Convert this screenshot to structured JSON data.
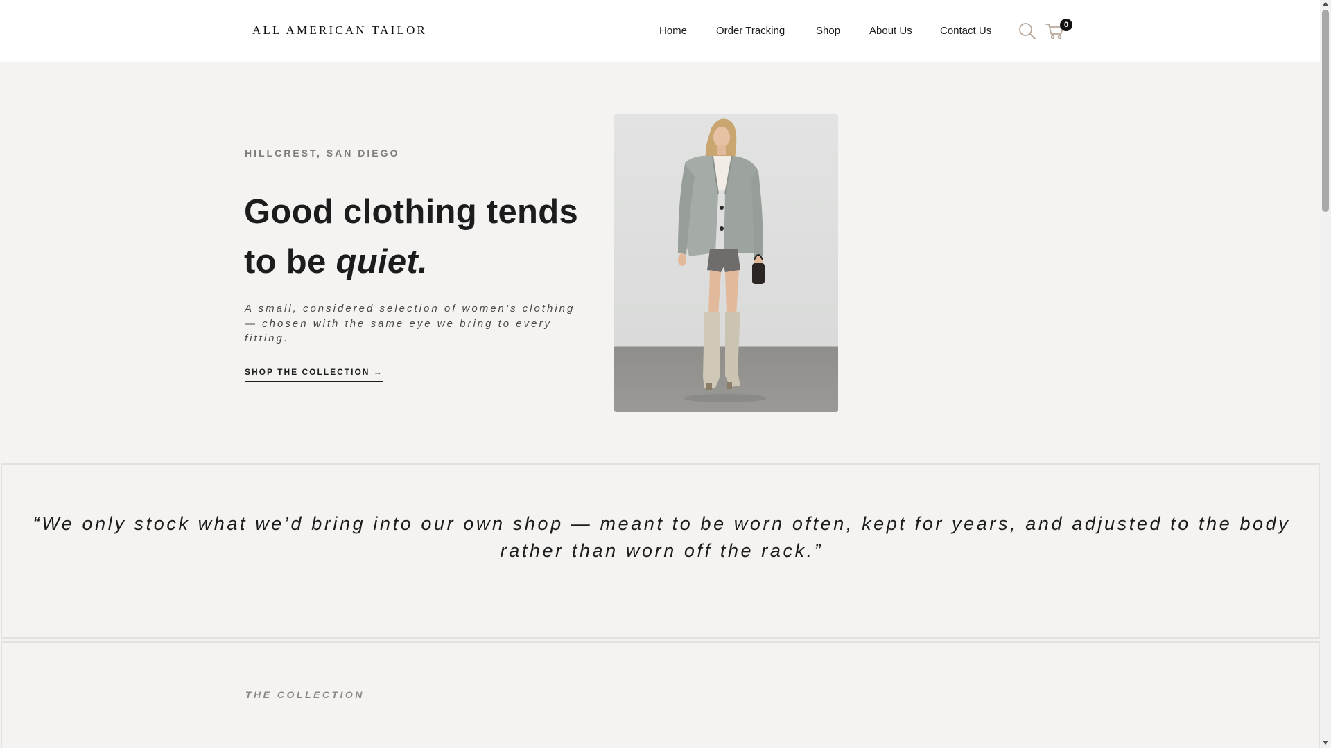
{
  "header": {
    "logo": "ALL AMERICAN TAILOR",
    "nav": [
      "Home",
      "Order Tracking",
      "Shop",
      "About Us",
      "Contact Us"
    ],
    "search_icon": "search-icon",
    "cart_icon": "cart-icon",
    "cart_count": "0"
  },
  "hero": {
    "eyebrow": "HILLCREST, SAN DIEGO",
    "title_line1": "Good clothing tends",
    "title_line2_prefix": "to be ",
    "title_emphasis": "quiet.",
    "subtitle": "A small, considered selection of women’s clothing — chosen with the same eye we bring to every fitting.",
    "cta": "SHOP THE COLLECTION →",
    "image": "model-in-grey-blazer-and-white-boots"
  },
  "quote": {
    "text": "“We only stock what we’d bring into our own shop — meant to be worn often, kept for years, and adjusted to the body rather than worn off the rack.”"
  },
  "collection": {
    "label": "THE COLLECTION"
  },
  "colors": {
    "page_bg": "#f4f3f1",
    "header_bg": "#ffffff",
    "text": "#1c1c1c",
    "muted": "#7f7d7a",
    "icon_accent": "#b9a89a"
  }
}
